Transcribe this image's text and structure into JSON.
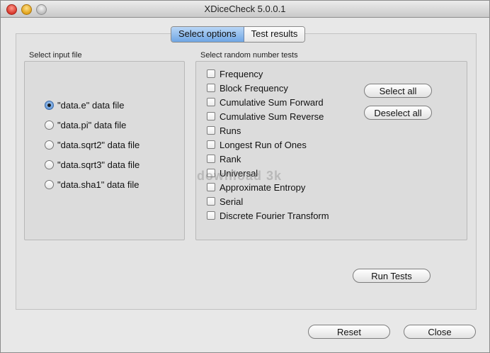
{
  "window": {
    "title": "XDiceCheck 5.0.0.1"
  },
  "tabs": [
    {
      "label": "Select options"
    },
    {
      "label": "Test results"
    }
  ],
  "input_file": {
    "label": "Select input file",
    "options": [
      {
        "label": "\"data.e\" data file",
        "selected": true
      },
      {
        "label": "\"data.pi\" data file",
        "selected": false
      },
      {
        "label": "\"data.sqrt2\" data file",
        "selected": false
      },
      {
        "label": "\"data.sqrt3\" data file",
        "selected": false
      },
      {
        "label": "\"data.sha1\" data file",
        "selected": false
      }
    ]
  },
  "tests": {
    "label": "Select random number tests",
    "items": [
      {
        "label": "Frequency"
      },
      {
        "label": "Block Frequency"
      },
      {
        "label": "Cumulative Sum Forward"
      },
      {
        "label": "Cumulative Sum Reverse"
      },
      {
        "label": "Runs"
      },
      {
        "label": "Longest Run of Ones"
      },
      {
        "label": "Rank"
      },
      {
        "label": "Universal"
      },
      {
        "label": "Approximate Entropy"
      },
      {
        "label": "Serial"
      },
      {
        "label": "Discrete Fourier Transform"
      }
    ],
    "select_all_label": "Select all",
    "deselect_all_label": "Deselect all"
  },
  "run_tests_label": "Run Tests",
  "reset_label": "Reset",
  "close_label": "Close",
  "watermark": "download 3k"
}
